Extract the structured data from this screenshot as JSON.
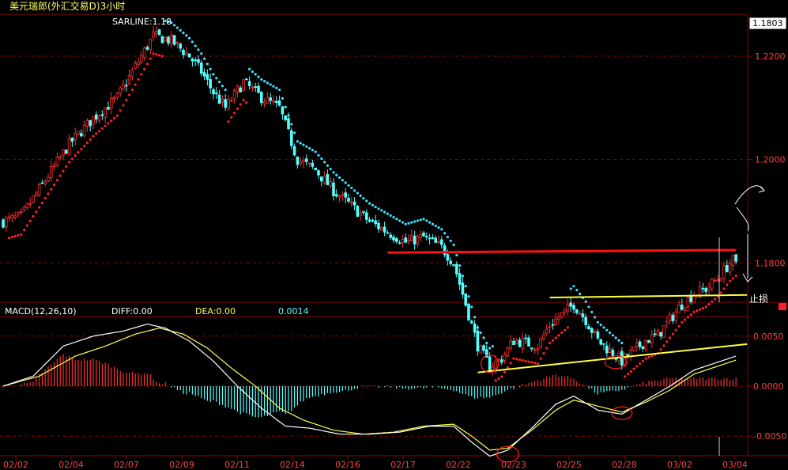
{
  "window": {
    "title": "美元瑞郎(外汇交易D)3小时",
    "current_price": "1.1803"
  },
  "indicator_label": "SARLINE:1.18",
  "stop_loss_label": "止损",
  "macd": {
    "title": "MACD(12,26,10)",
    "diff_label": "DIFF:0.00",
    "dea_label": "DEA:0.00",
    "value": "0.0014"
  },
  "colors": {
    "background": "#000000",
    "grid": "#8b0000",
    "up": "#ff3030",
    "down": "#54ffff",
    "sar_up": "#ff2020",
    "sar_down": "#40e0ff",
    "resistance": "#ff1010",
    "trendline": "#ffff40",
    "diff": "#ffffff",
    "dea": "#ffff50"
  },
  "chart_data": [
    {
      "type": "candlestick",
      "title": "美元瑞郎(外汇交易D)3小时",
      "ylim": [
        1.173,
        1.2275
      ],
      "y_ticks": [
        {
          "value": 1.22,
          "label": "1.2200"
        },
        {
          "value": 1.2,
          "label": "1.2000"
        },
        {
          "value": 1.18,
          "label": "1.1800"
        }
      ],
      "x_ticks": [
        "02/02",
        "02/04",
        "02/07",
        "02/09",
        "02/11",
        "02/14",
        "02/16",
        "02/17",
        "02/22",
        "02/23",
        "02/25",
        "02/28",
        "03/02",
        "03/04"
      ],
      "last_price": 1.1803,
      "anchors": [
        [
          0,
          1.188
        ],
        [
          6,
          1.189
        ],
        [
          14,
          1.196
        ],
        [
          22,
          1.203
        ],
        [
          30,
          1.208
        ],
        [
          38,
          1.212
        ],
        [
          44,
          1.218
        ],
        [
          50,
          1.224
        ],
        [
          56,
          1.223
        ],
        [
          62,
          1.22
        ],
        [
          66,
          1.217
        ],
        [
          70,
          1.213
        ],
        [
          74,
          1.21
        ],
        [
          80,
          1.215
        ],
        [
          86,
          1.212
        ],
        [
          92,
          1.21
        ],
        [
          98,
          1.2
        ],
        [
          104,
          1.198
        ],
        [
          110,
          1.194
        ],
        [
          116,
          1.191
        ],
        [
          122,
          1.188
        ],
        [
          128,
          1.186
        ],
        [
          134,
          1.184
        ],
        [
          140,
          1.185
        ],
        [
          146,
          1.183
        ],
        [
          150,
          1.18
        ],
        [
          154,
          1.172
        ],
        [
          158,
          1.164
        ],
        [
          162,
          1.16
        ],
        [
          166,
          1.1615
        ],
        [
          170,
          1.165
        ],
        [
          174,
          1.1645
        ],
        [
          178,
          1.164
        ],
        [
          182,
          1.168
        ],
        [
          186,
          1.17
        ],
        [
          190,
          1.172
        ],
        [
          194,
          1.169
        ],
        [
          198,
          1.165
        ],
        [
          202,
          1.163
        ],
        [
          206,
          1.161
        ],
        [
          210,
          1.163
        ],
        [
          214,
          1.165
        ],
        [
          218,
          1.166
        ],
        [
          222,
          1.169
        ],
        [
          226,
          1.172
        ],
        [
          230,
          1.174
        ],
        [
          234,
          1.175
        ],
        [
          238,
          1.177
        ],
        [
          242,
          1.18
        ],
        [
          244,
          1.181
        ]
      ],
      "resistance_line": [
        [
          128,
          1.182
        ],
        [
          244,
          1.1825
        ]
      ],
      "trend_lines": [
        {
          "from": [
            158,
            1.1588
          ],
          "to": [
            244,
            1.1643
          ]
        },
        {
          "from": [
            182,
            1.1733
          ],
          "to": [
            244,
            1.1738
          ]
        }
      ]
    },
    {
      "type": "macd",
      "title": "MACD(12,26,10)",
      "ylim": [
        -0.0068,
        0.0068
      ],
      "y_ticks": [
        {
          "value": 0.005,
          "label": "0.0050"
        },
        {
          "value": 0.0,
          "label": "0.0000"
        },
        {
          "value": -0.005,
          "label": "-0.0050"
        }
      ],
      "diff_anchors": [
        [
          0,
          0.0
        ],
        [
          10,
          0.001
        ],
        [
          20,
          0.004
        ],
        [
          30,
          0.005
        ],
        [
          40,
          0.0055
        ],
        [
          48,
          0.0062
        ],
        [
          54,
          0.0058
        ],
        [
          62,
          0.0045
        ],
        [
          70,
          0.0025
        ],
        [
          78,
          0.0
        ],
        [
          86,
          -0.0022
        ],
        [
          94,
          -0.004
        ],
        [
          102,
          -0.0042
        ],
        [
          112,
          -0.0048
        ],
        [
          122,
          -0.0048
        ],
        [
          132,
          -0.0046
        ],
        [
          142,
          -0.004
        ],
        [
          150,
          -0.004
        ],
        [
          156,
          -0.0056
        ],
        [
          162,
          -0.007
        ],
        [
          168,
          -0.0064
        ],
        [
          176,
          -0.0042
        ],
        [
          184,
          -0.0018
        ],
        [
          190,
          -0.001
        ],
        [
          198,
          -0.0024
        ],
        [
          206,
          -0.0028
        ],
        [
          214,
          -0.0014
        ],
        [
          222,
          0.0
        ],
        [
          230,
          0.0016
        ],
        [
          238,
          0.0024
        ],
        [
          244,
          0.003
        ]
      ],
      "dea_anchors": [
        [
          0,
          0.0
        ],
        [
          12,
          0.001
        ],
        [
          24,
          0.003
        ],
        [
          34,
          0.004
        ],
        [
          44,
          0.0052
        ],
        [
          52,
          0.0058
        ],
        [
          60,
          0.0052
        ],
        [
          68,
          0.0038
        ],
        [
          76,
          0.0018
        ],
        [
          84,
          0.0
        ],
        [
          92,
          -0.0022
        ],
        [
          100,
          -0.0034
        ],
        [
          110,
          -0.0044
        ],
        [
          120,
          -0.0048
        ],
        [
          130,
          -0.0046
        ],
        [
          140,
          -0.004
        ],
        [
          150,
          -0.0038
        ],
        [
          156,
          -0.005
        ],
        [
          162,
          -0.0064
        ],
        [
          168,
          -0.0062
        ],
        [
          176,
          -0.0044
        ],
        [
          184,
          -0.0024
        ],
        [
          190,
          -0.0014
        ],
        [
          198,
          -0.002
        ],
        [
          206,
          -0.0026
        ],
        [
          214,
          -0.0016
        ],
        [
          222,
          -0.0004
        ],
        [
          230,
          0.0012
        ],
        [
          238,
          0.002
        ],
        [
          244,
          0.0026
        ]
      ]
    }
  ]
}
